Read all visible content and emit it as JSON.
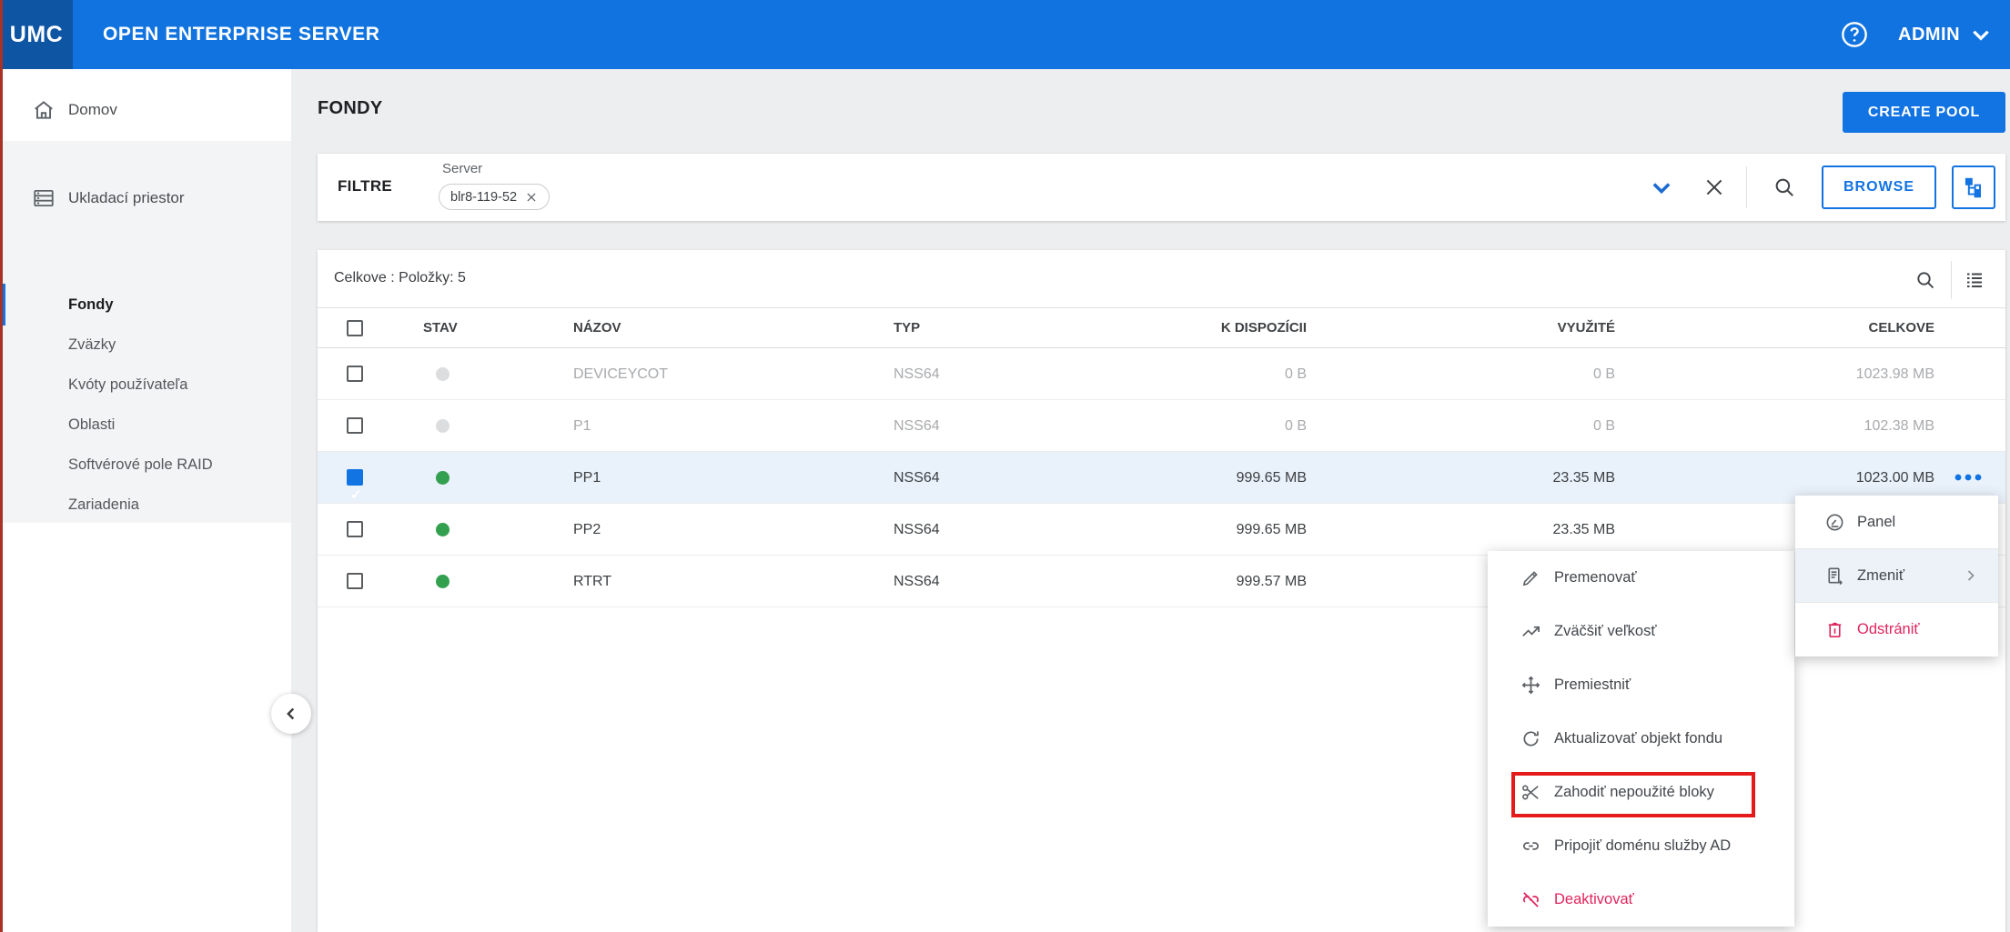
{
  "topbar": {
    "logo": "UMC",
    "title": "OPEN ENTERPRISE SERVER",
    "user": "ADMIN",
    "help_icon": "help-circle-icon",
    "user_chevron_icon": "chevron-down-icon"
  },
  "sidebar": {
    "home": {
      "label": "Domov",
      "icon": "home-icon"
    },
    "section": {
      "label": "Ukladací priestor",
      "icon": "storage-icon"
    },
    "items": [
      {
        "label": "Fondy",
        "active": true
      },
      {
        "label": "Zväzky",
        "active": false
      },
      {
        "label": "Kvóty používateľa",
        "active": false
      },
      {
        "label": "Oblasti",
        "active": false
      },
      {
        "label": "Softvérové pole RAID",
        "active": false
      },
      {
        "label": "Zariadenia",
        "active": false
      }
    ],
    "collapse_icon": "chevron-left-icon"
  },
  "page": {
    "title": "FONDY",
    "create_button": "CREATE POOL"
  },
  "filter": {
    "label": "FILTRE",
    "field_label": "Server",
    "chip": "blr8-119-52",
    "chip_remove_icon": "close-icon",
    "expand_icon": "chevron-down-icon",
    "clear_icon": "close-icon",
    "search_icon": "search-icon",
    "browse_button": "BROWSE",
    "tree_button_icon": "tree-hierarchy-icon"
  },
  "table": {
    "summary": "Celkove : Položky: 5",
    "toolbar_icons": [
      "search-icon",
      "list-filter-icon"
    ],
    "columns": [
      "STAV",
      "NÁZOV",
      "TYP",
      "K DISPOZÍCII",
      "VYUŽITÉ",
      "CELKOVE"
    ],
    "rows": [
      {
        "name": "DEVICEYCOT",
        "type": "NSS64",
        "available": "0 B",
        "used": "0 B",
        "total": "1023.98 MB",
        "status": "offline",
        "selected": false
      },
      {
        "name": "P1",
        "type": "NSS64",
        "available": "0 B",
        "used": "0 B",
        "total": "102.38 MB",
        "status": "offline",
        "selected": false
      },
      {
        "name": "PP1",
        "type": "NSS64",
        "available": "999.65 MB",
        "used": "23.35 MB",
        "total": "1023.00 MB",
        "status": "online",
        "selected": true,
        "more_icon": "more-horiz-icon"
      },
      {
        "name": "PP2",
        "type": "NSS64",
        "available": "999.65 MB",
        "used": "23.35 MB",
        "total": "",
        "status": "online",
        "selected": false
      },
      {
        "name": "RTRT",
        "type": "NSS64",
        "available": "999.57 MB",
        "used": "",
        "total": "",
        "status": "online",
        "selected": false
      }
    ]
  },
  "context_menu": {
    "items": [
      {
        "label": "Premenovať",
        "icon": "pencil-icon"
      },
      {
        "label": "Zväčšiť veľkosť",
        "icon": "trending-up-icon"
      },
      {
        "label": "Premiestniť",
        "icon": "move-icon"
      },
      {
        "label": "Aktualizovať objekt fondu",
        "icon": "refresh-icon"
      },
      {
        "label": "Zahodiť nepoužité bloky",
        "icon": "scissors-icon",
        "annotated": true
      },
      {
        "label": "Pripojiť doménu služby AD",
        "icon": "link-icon"
      },
      {
        "label": "Deaktivovať",
        "icon": "link-off-icon",
        "danger": true
      }
    ]
  },
  "submenu": {
    "items": [
      {
        "label": "Panel",
        "icon": "gauge-icon"
      },
      {
        "label": "Zmeniť",
        "icon": "edit-doc-icon",
        "highlighted": true,
        "has_submenu": true,
        "chevron_icon": "chevron-right-icon"
      },
      {
        "label": "Odstrániť",
        "icon": "trash-icon",
        "danger": true
      }
    ]
  },
  "colors": {
    "accent": "#1273e2",
    "topbar": "#1173df",
    "logo_box": "#0e55a4",
    "danger": "#e0255e",
    "green": "#33a04f",
    "row_highlight": "#e9f1fb",
    "annotation_red": "#e51b1b"
  }
}
